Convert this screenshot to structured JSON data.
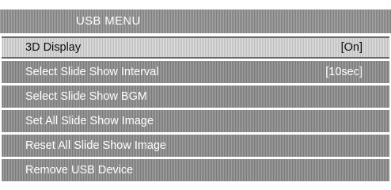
{
  "menu": {
    "title": "USB MENU",
    "items": [
      {
        "label": "3D Display",
        "value": "[On]",
        "selected": true
      },
      {
        "label": "Select Slide Show Interval",
        "value": "[10sec]",
        "selected": false
      },
      {
        "label": "Select Slide Show BGM",
        "value": "",
        "selected": false
      },
      {
        "label": "Set All Slide Show Image",
        "value": "",
        "selected": false
      },
      {
        "label": "Reset All Slide Show Image",
        "value": "",
        "selected": false
      },
      {
        "label": "Remove USB Device",
        "value": "",
        "selected": false
      }
    ]
  }
}
